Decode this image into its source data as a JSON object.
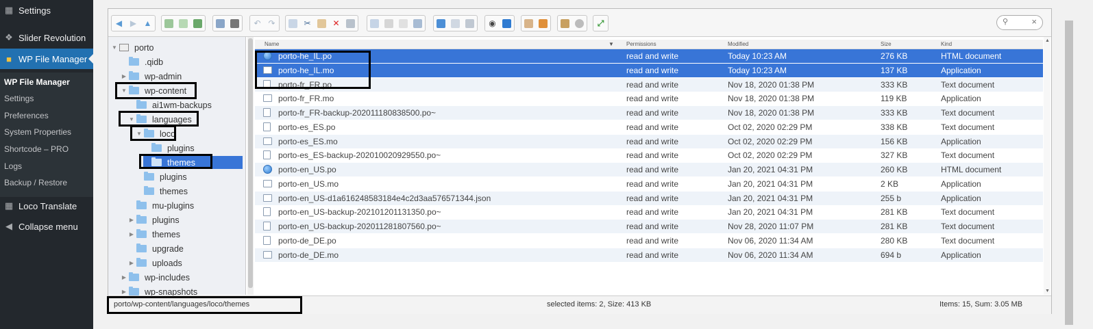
{
  "wp_menu": {
    "settings": "Settings",
    "slider_revolution": "Slider Revolution",
    "wp_file_manager": "WP File Manager",
    "submenu": [
      "WP File Manager",
      "Settings",
      "Preferences",
      "System Properties",
      "Shortcode – PRO",
      "Logs",
      "Backup / Restore"
    ],
    "loco_translate": "Loco Translate",
    "collapse_menu": "Collapse menu"
  },
  "tree": {
    "root": "porto",
    "nodes": [
      ".qidb",
      "wp-admin",
      "wp-content",
      "ai1wm-backups",
      "languages",
      "loco",
      "plugins",
      "themes",
      "plugins",
      "themes",
      "mu-plugins",
      "plugins",
      "themes",
      "upgrade",
      "uploads",
      "wp-includes",
      "wp-snapshots"
    ]
  },
  "columns": {
    "name": "Name",
    "permissions": "Permissions",
    "modified": "Modified",
    "size": "Size",
    "kind": "Kind"
  },
  "files": [
    {
      "name": "porto-he_IL.po",
      "perm": "read and write",
      "modified": "Today 10:23 AM",
      "size": "276 KB",
      "kind": "HTML document"
    },
    {
      "name": "porto-he_IL.mo",
      "perm": "read and write",
      "modified": "Today 10:23 AM",
      "size": "137 KB",
      "kind": "Application"
    },
    {
      "name": "porto-fr_FR.po",
      "perm": "read and write",
      "modified": "Nov 18, 2020 01:38 PM",
      "size": "333 KB",
      "kind": "Text document"
    },
    {
      "name": "porto-fr_FR.mo",
      "perm": "read and write",
      "modified": "Nov 18, 2020 01:38 PM",
      "size": "119 KB",
      "kind": "Application"
    },
    {
      "name": "porto-fr_FR-backup-202011180838500.po~",
      "perm": "read and write",
      "modified": "Nov 18, 2020 01:38 PM",
      "size": "333 KB",
      "kind": "Text document"
    },
    {
      "name": "porto-es_ES.po",
      "perm": "read and write",
      "modified": "Oct 02, 2020 02:29 PM",
      "size": "338 KB",
      "kind": "Text document"
    },
    {
      "name": "porto-es_ES.mo",
      "perm": "read and write",
      "modified": "Oct 02, 2020 02:29 PM",
      "size": "156 KB",
      "kind": "Application"
    },
    {
      "name": "porto-es_ES-backup-202010020929550.po~",
      "perm": "read and write",
      "modified": "Oct 02, 2020 02:29 PM",
      "size": "327 KB",
      "kind": "Text document"
    },
    {
      "name": "porto-en_US.po",
      "perm": "read and write",
      "modified": "Jan 20, 2021 04:31 PM",
      "size": "260 KB",
      "kind": "HTML document"
    },
    {
      "name": "porto-en_US.mo",
      "perm": "read and write",
      "modified": "Jan 20, 2021 04:31 PM",
      "size": "2 KB",
      "kind": "Application"
    },
    {
      "name": "porto-en_US-d1a616248583184e4c2d3aa576571344.json",
      "perm": "read and write",
      "modified": "Jan 20, 2021 04:31 PM",
      "size": "255 b",
      "kind": "Application"
    },
    {
      "name": "porto-en_US-backup-202101201131350.po~",
      "perm": "read and write",
      "modified": "Jan 20, 2021 04:31 PM",
      "size": "281 KB",
      "kind": "Text document"
    },
    {
      "name": "porto-en_US-backup-202011281807560.po~",
      "perm": "read and write",
      "modified": "Nov 28, 2020 11:07 PM",
      "size": "281 KB",
      "kind": "Text document"
    },
    {
      "name": "porto-de_DE.po",
      "perm": "read and write",
      "modified": "Nov 06, 2020 11:34 AM",
      "size": "280 KB",
      "kind": "Text document"
    },
    {
      "name": "porto-de_DE.mo",
      "perm": "read and write",
      "modified": "Nov 06, 2020 11:34 AM",
      "size": "694 b",
      "kind": "Application"
    }
  ],
  "status": {
    "path": "porto/wp-content/languages/loco/themes",
    "selected": "selected items: 2, Size: 413 KB",
    "total": "Items: 15, Sum: 3.05 MB"
  },
  "colors": {
    "wp_sidebar": "#23282d",
    "wp_active": "#2271b1",
    "selection": "#3875d7",
    "folder": "#8ec0ec"
  }
}
